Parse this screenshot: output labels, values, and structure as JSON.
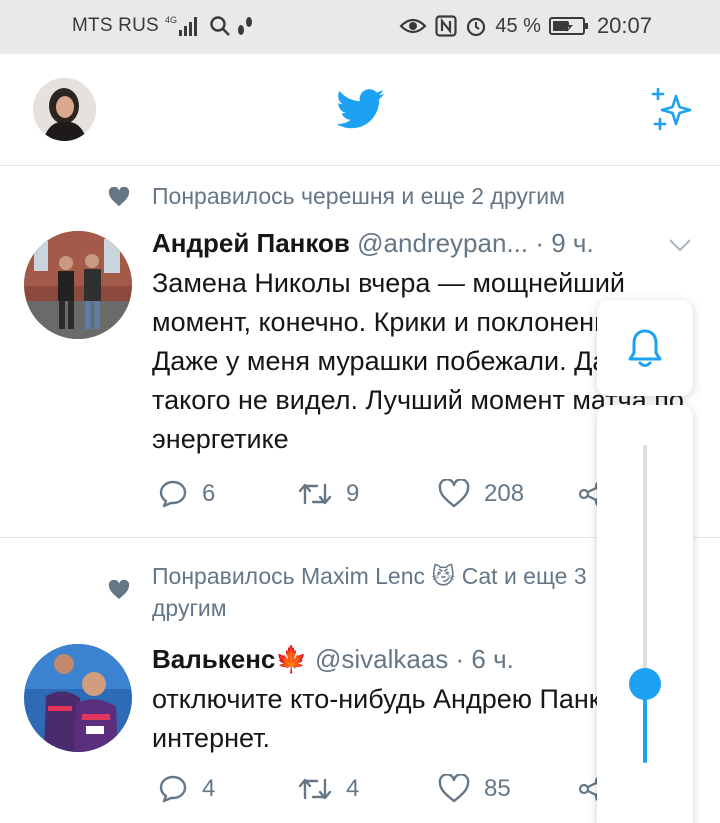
{
  "status_bar": {
    "carrier": "MTS RUS",
    "network": "4G",
    "battery_percent": "45 %",
    "time": "20:07"
  },
  "header": {
    "logo": "twitter-bird-icon",
    "right_icon": "sparkle-icon"
  },
  "tweets": [
    {
      "social_context": "Понравилось черешня и еще 2 другим",
      "name": "Андрей Панков",
      "handle": "@andreypan...",
      "time": "· 9 ч.",
      "text": "Замена Николы вчера — мощнейший момент, конечно. Крики и поклонения. Даже у меня мурашки побежали. Давно такого не видел. Лучший момент матча по энергетике",
      "replies": "6",
      "retweets": "9",
      "likes": "208"
    },
    {
      "social_context": "Понравилось Maxim Lenc 😼 Cat и еще 3 другим",
      "name": "Валькенс🍁",
      "handle": "@sivalkaas",
      "time": "· 6 ч.",
      "text": "отключите кто-нибудь Андрею Панкову интернет.",
      "replies": "4",
      "retweets": "4",
      "likes": "85"
    }
  ],
  "overlay": {
    "top_icon": "bell-icon",
    "slider_level": 0.25
  },
  "colors": {
    "accent": "#1da1f2",
    "muted": "#657786",
    "text": "#14171a",
    "divider": "#e1e8ed"
  }
}
